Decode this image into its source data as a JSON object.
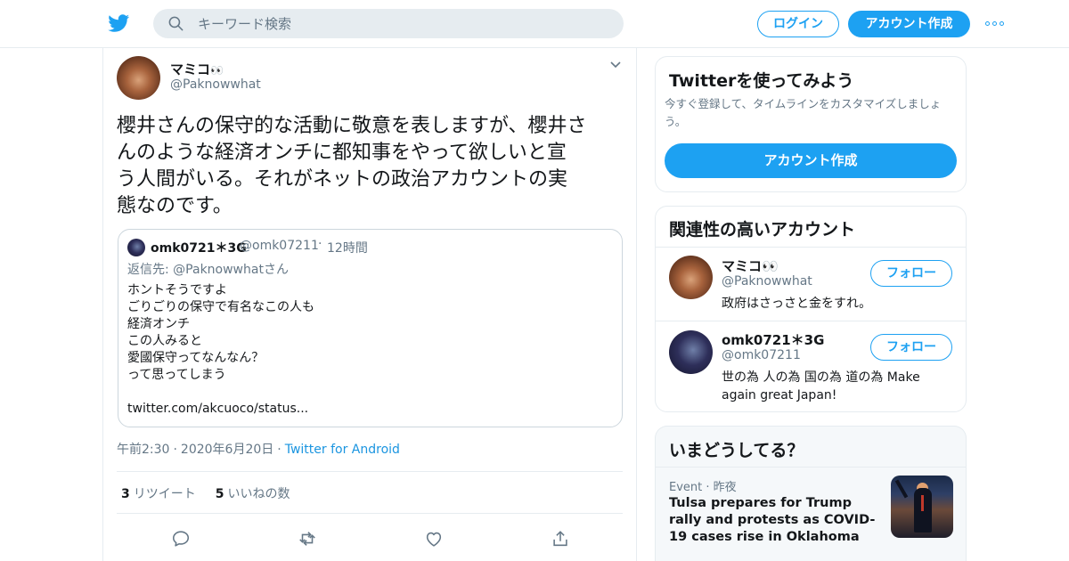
{
  "header": {
    "search_placeholder": "キーワード検索",
    "login_label": "ログイン",
    "signup_label": "アカウント作成"
  },
  "tweet": {
    "author_name": "マミコ",
    "author_emoji": "👀",
    "author_handle": "@Paknowwhat",
    "text": "櫻井さんの保守的な活動に敬意を表しますが、櫻井さ\nんのような経済オンチに都知事をやって欲しいと宣\nう人間がいる。それがネットの政治アカウントの実\n態なのです。",
    "quoted": {
      "name": "omk0721＊3G",
      "handle": "@omk07211",
      "separator": "·",
      "time": "12時間",
      "reply_prefix": "返信先:",
      "reply_to": "@Paknowwhatさん",
      "body": "ホントそうですよ\nごりごりの保守で有名なこの人も\n経済オンチ\nこの人みると\n愛國保守ってなんなん？\nって思ってしまう\n\ntwitter.com/akcuoco/status..."
    },
    "time": "午前2:30",
    "date": "2020年6月20日",
    "separator": "·",
    "source": "Twitter for Android",
    "retweet_count": "3",
    "retweet_label": "リツイート",
    "like_count": "5",
    "like_label": "いいねの数"
  },
  "sidebar": {
    "signup_card": {
      "title": "Twitterを使ってみよう",
      "description": "今すぐ登録して、タイムラインをカスタマイズしましょう。",
      "button_label": "アカウント作成"
    },
    "related": {
      "title": "関連性の高いアカウント",
      "accounts": [
        {
          "name": "マミコ👀",
          "handle": "@Paknowwhat",
          "bio": "政府はさっさと金をすれ。",
          "follow_label": "フォロー"
        },
        {
          "name": "omk0721＊3G",
          "handle": "@omk07211",
          "bio": "世の為 人の為 国の為 道の為 Make again great Japan!",
          "follow_label": "フォロー"
        }
      ]
    },
    "trends": {
      "title": "いまどうしてる？",
      "items": [
        {
          "category": "Event",
          "separator": "·",
          "when": "昨夜",
          "headline": "Tulsa prepares for Trump rally and protests as COVID-19 cases rise in Oklahoma"
        }
      ]
    }
  },
  "colors": {
    "accent": "#1da1f2",
    "link": "#1b95e0",
    "text_primary": "#14171a",
    "text_secondary": "#657786",
    "border": "#e6ecf0"
  },
  "icons": {
    "logo": "twitter-bird-icon",
    "search": "search-icon",
    "more": "more-dots-icon",
    "caret": "chevron-down-icon",
    "reply": "reply-icon",
    "retweet": "retweet-icon",
    "like": "heart-icon",
    "share": "share-icon"
  }
}
